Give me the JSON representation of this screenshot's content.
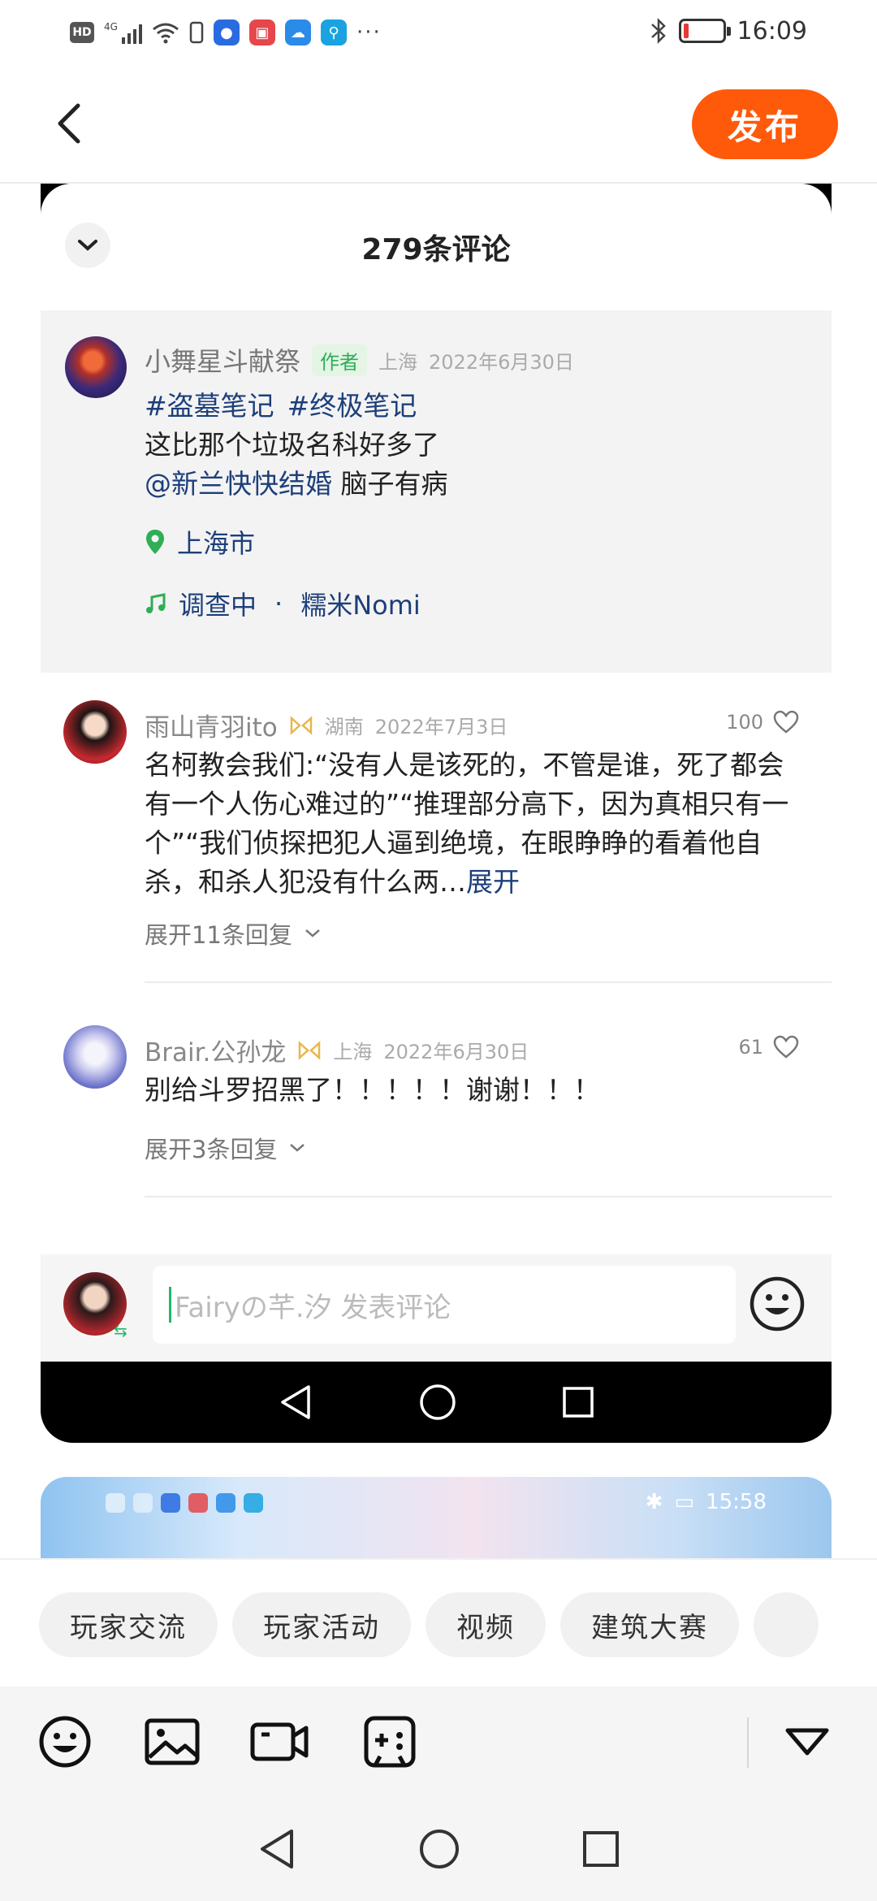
{
  "status_bar": {
    "left_badge": "HD",
    "network": "4G",
    "time": "16:09",
    "battery_level": 0.12,
    "icons": [
      "hd-icon",
      "signal-icon",
      "wifi-icon",
      "phone-icon",
      "bulb-app-icon",
      "book-app-icon",
      "weather-app-icon",
      "search-app-icon",
      "more-icon",
      "bluetooth-icon",
      "battery-icon"
    ],
    "more": "···"
  },
  "header": {
    "publish_label": "发布"
  },
  "embedded": {
    "comment_count": "279条评论",
    "post": {
      "author": "小舞星斗献祭",
      "author_tag": "作者",
      "location": "上海",
      "date": "2022年6月30日",
      "tags": [
        "#盗墓笔记",
        "#终极笔记"
      ],
      "line1": "这比那个垃圾名科好多了",
      "mention": "@新兰快快结婚",
      "mention_suffix": " 脑子有病",
      "place": "上海市",
      "music_title": "调查中",
      "music_sep": "·",
      "music_artist": "糯米Nomi"
    },
    "comments": [
      {
        "name": "雨山青羽ito",
        "location": "湖南",
        "date": "2022年7月3日",
        "likes": "100",
        "text": "名柯教会我们:“没有人是该死的，不管是谁，死了都会有一个人伤心难过的”“推理部分高下，因为真相只有一个”“我们侦探把犯人逼到绝境，在眼睁睁的看着他自杀，和杀人犯没有什么两…",
        "expand": "展开",
        "replies": "展开11条回复"
      },
      {
        "name": "Brair.公孙龙",
        "location": "上海",
        "date": "2022年6月30日",
        "likes": "61",
        "text": "别给斗罗招黑了！！！！！谢谢！！！",
        "replies": "展开3条回复"
      }
    ],
    "input_placeholder": "Fairyの芊.汐 发表评论",
    "shot2_time": "15:58"
  },
  "chips": [
    "玩家交流",
    "玩家活动",
    "视频",
    "建筑大赛"
  ],
  "toolbar": {
    "icons": [
      "emoji-icon",
      "image-icon",
      "video-icon",
      "gamepad-icon",
      "collapse-triangle-icon"
    ]
  },
  "colors": {
    "accent": "#ff5a0a",
    "link": "#1d3f7a",
    "tag_green": "#2fae55"
  }
}
